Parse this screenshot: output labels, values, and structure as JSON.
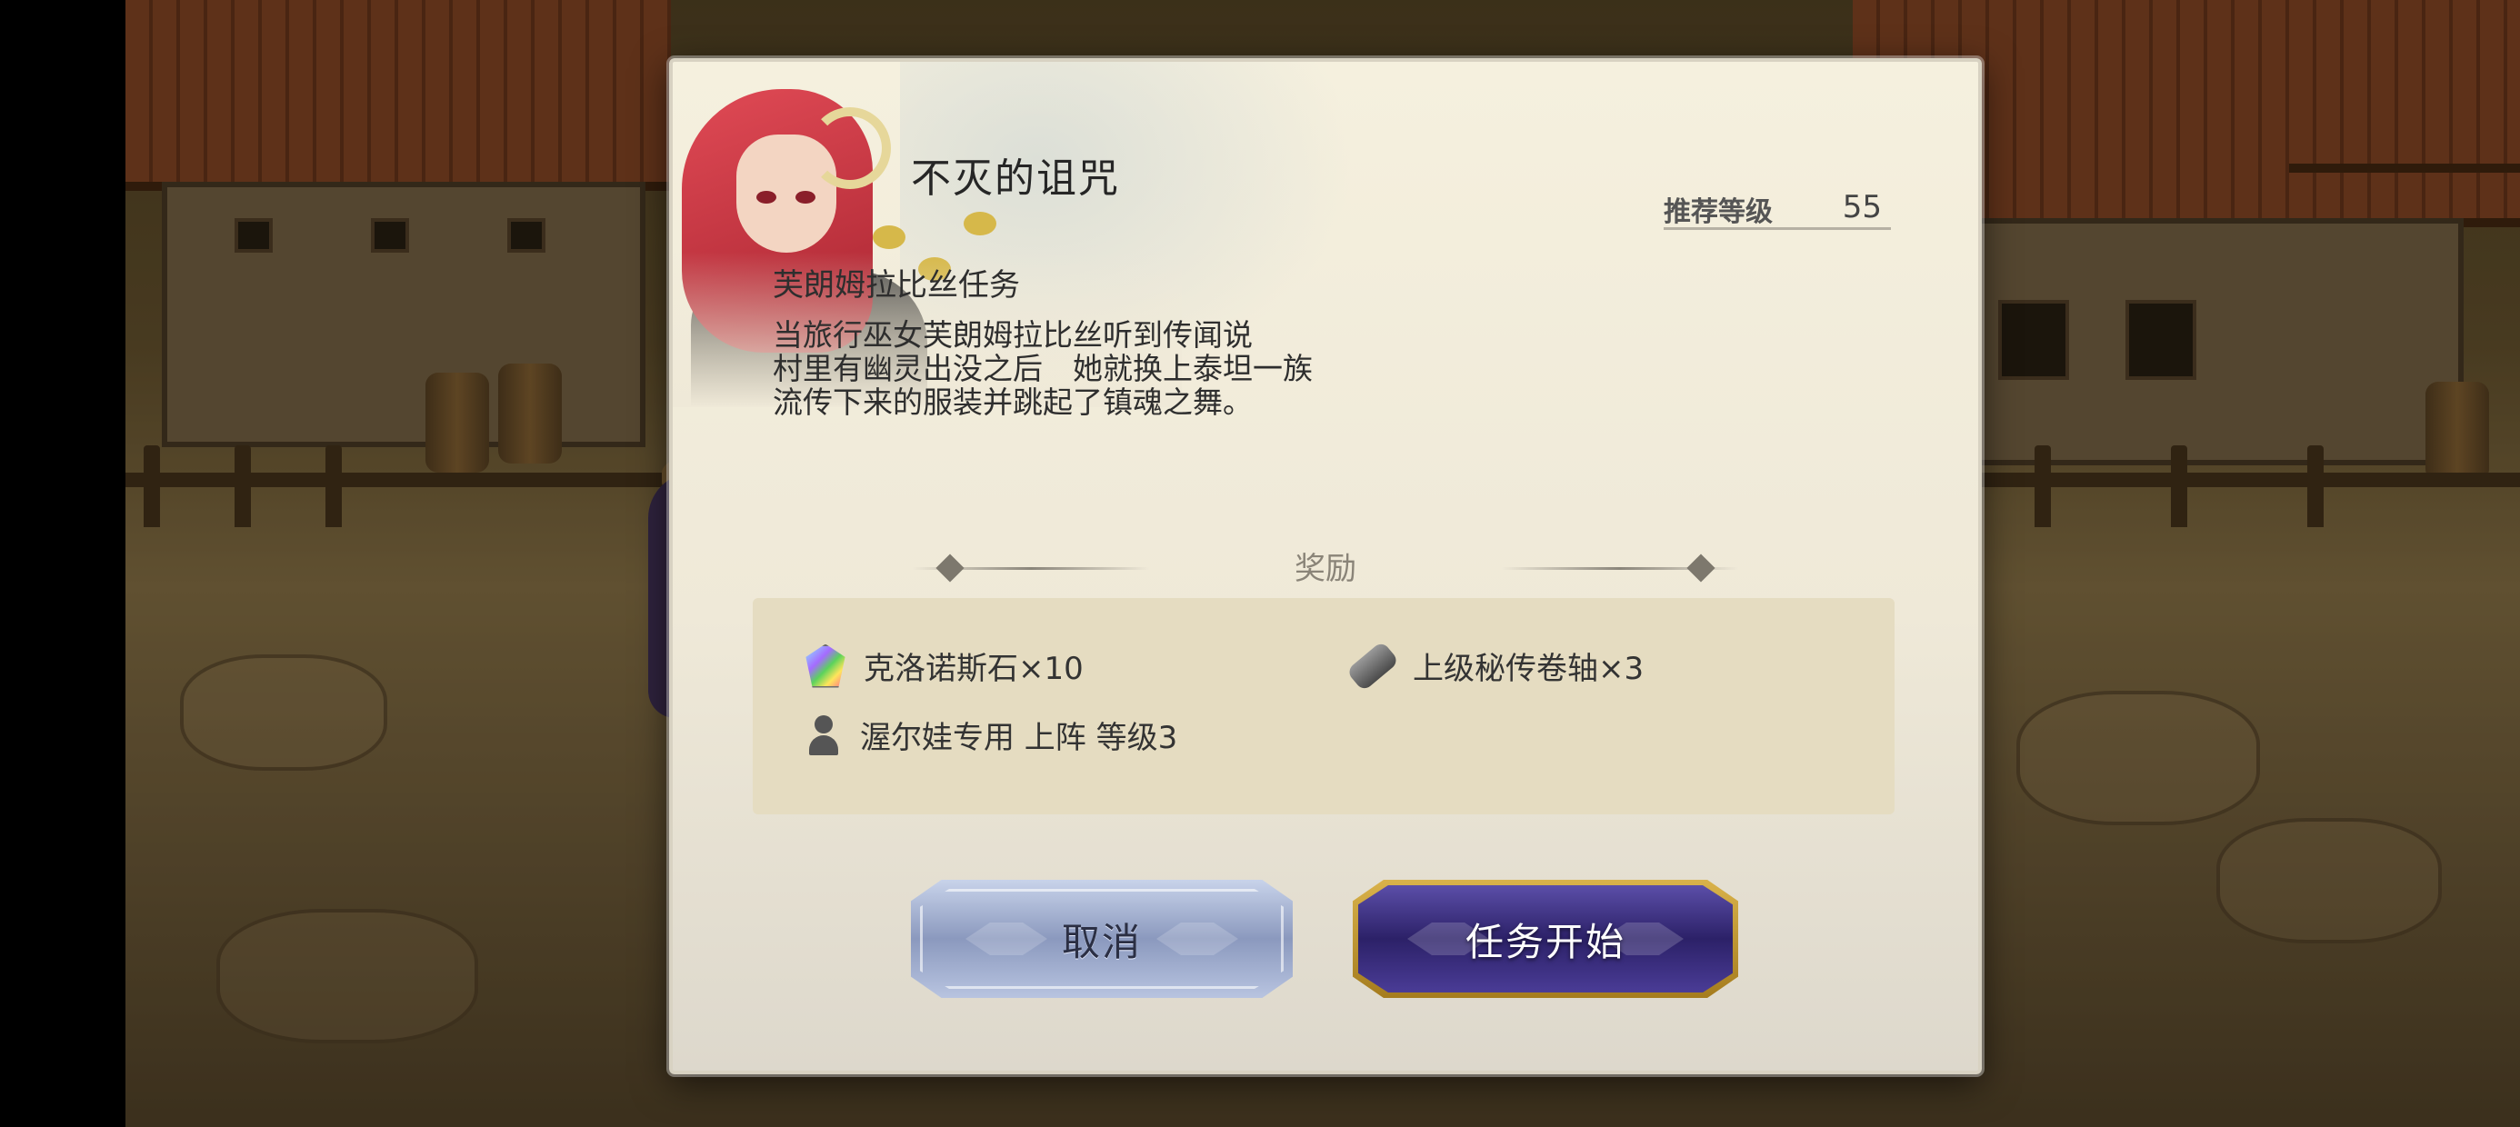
{
  "quest": {
    "title": "不灭的诅咒",
    "recommended_level_label": "推荐等级",
    "recommended_level_value": "55",
    "subtitle": "芙朗姆拉比丝任务",
    "description": "当旅行巫女芙朗姆拉比丝听到传闻说\n村里有幽灵出没之后　她就换上泰坦一族\n流传下来的服装并跳起了镇魂之舞。"
  },
  "rewards": {
    "header": "奖励",
    "items": [
      {
        "icon": "crystal-icon",
        "label": "克洛诺斯石×10"
      },
      {
        "icon": "scroll-icon",
        "label": "上级秘传卷轴×3"
      },
      {
        "icon": "person-icon",
        "label": "渥尔娃专用 上阵 等级3"
      }
    ]
  },
  "buttons": {
    "cancel": "取消",
    "start": "任务开始"
  }
}
